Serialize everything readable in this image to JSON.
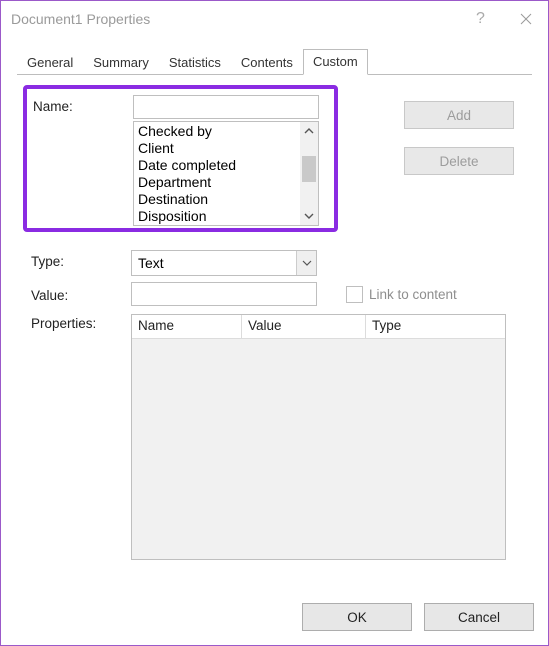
{
  "window": {
    "title": "Document1 Properties"
  },
  "tabs": {
    "general": "General",
    "summary": "Summary",
    "statistics": "Statistics",
    "contents": "Contents",
    "custom": "Custom"
  },
  "labels": {
    "name": "Name:",
    "type": "Type:",
    "value": "Value:",
    "properties": "Properties:",
    "link_to_content": "Link to content"
  },
  "buttons": {
    "add": "Add",
    "delete": "Delete",
    "ok": "OK",
    "cancel": "Cancel"
  },
  "name_input": "",
  "value_input": "",
  "name_suggestions": [
    "Checked by",
    "Client",
    "Date completed",
    "Department",
    "Destination",
    "Disposition"
  ],
  "type_select": {
    "value": "Text"
  },
  "link_to_content_checked": false,
  "table": {
    "columns": {
      "name": "Name",
      "value": "Value",
      "type": "Type"
    },
    "rows": []
  }
}
